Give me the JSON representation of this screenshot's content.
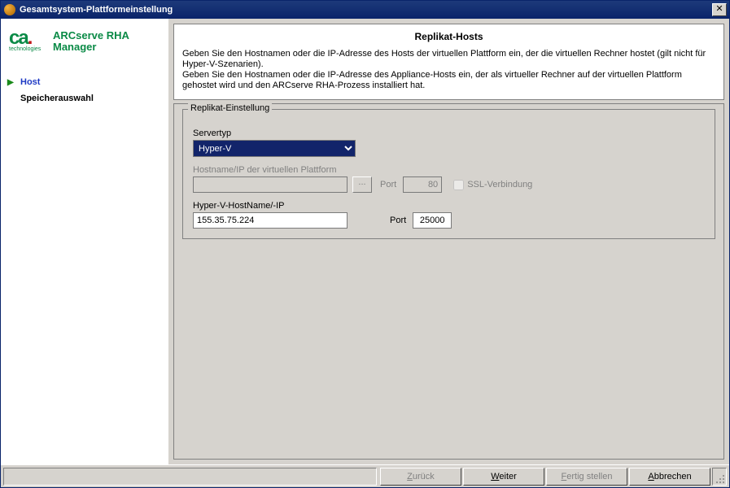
{
  "window": {
    "title": "Gesamtsystem-Plattformeinstellung"
  },
  "branding": {
    "line1": "ARCserve RHA",
    "line2": "Manager",
    "logo_top": "ca",
    "logo_sub": "technologies"
  },
  "nav": {
    "items": [
      {
        "label": "Host",
        "active": true
      },
      {
        "label": "Speicherauswahl",
        "active": false
      }
    ]
  },
  "header": {
    "title": "Replikat-Hosts",
    "p1": "Geben Sie den Hostnamen oder die IP-Adresse des Hosts der virtuellen Plattform ein, der die virtuellen Rechner hostet (gilt nicht für Hyper-V-Szenarien).",
    "p2": "Geben Sie den Hostnamen oder die IP-Adresse des Appliance-Hosts ein, der als virtueller Rechner auf der virtuellen Plattform gehostet wird und den ARCserve RHA-Prozess installiert hat."
  },
  "group": {
    "legend": "Replikat-Einstellung",
    "servertype_label": "Servertyp",
    "servertype_value": "Hyper-V",
    "servertype_options": [
      "Hyper-V"
    ],
    "vp_label": "Hostname/IP der virtuellen Plattform",
    "vp_value": "",
    "vp_port_label": "Port",
    "vp_port_value": "80",
    "ssl_label": "SSL-Verbindung",
    "ssl_checked": false,
    "hv_label": "Hyper-V-HostName/-IP",
    "hv_value": "155.35.75.224",
    "hv_port_label": "Port",
    "hv_port_value": "25000",
    "browse_label": "..."
  },
  "footer": {
    "back": "Zurück",
    "next": "Weiter",
    "finish": "Fertig stellen",
    "cancel": "Abbrechen"
  }
}
